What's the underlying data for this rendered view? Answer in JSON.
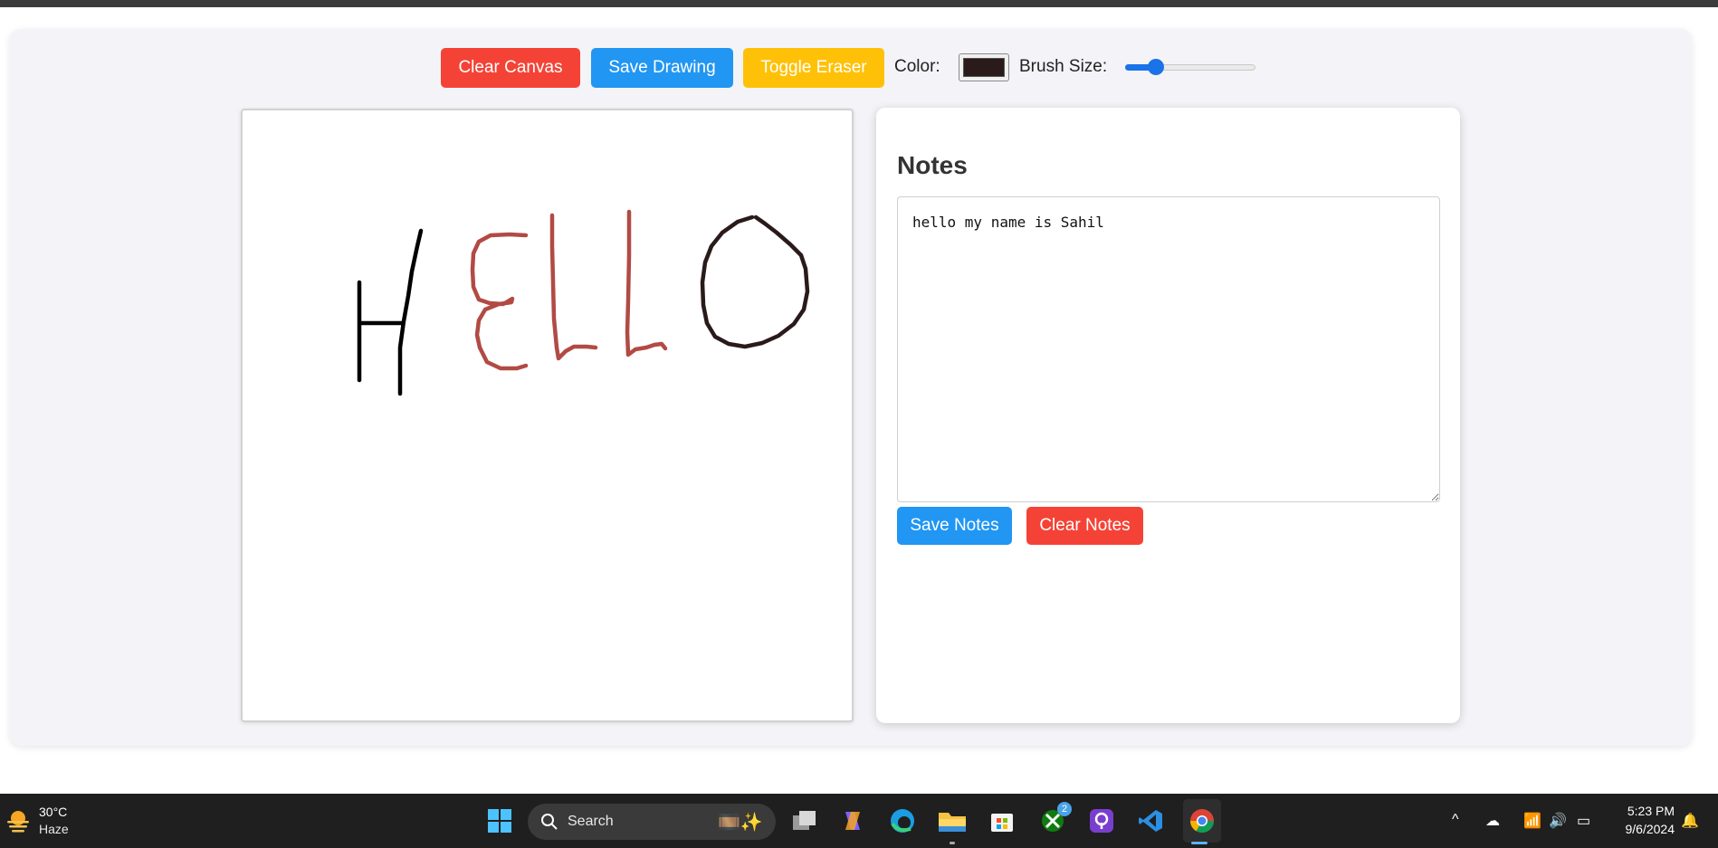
{
  "toolbar": {
    "clear_canvas_label": "Clear Canvas",
    "save_drawing_label": "Save Drawing",
    "toggle_eraser_label": "Toggle Eraser",
    "color_label": "Color:",
    "color_value": "#2a1a1a",
    "brush_size_label": "Brush Size:",
    "brush_size_fraction": 0.2,
    "colors": {
      "clear": "#f44336",
      "save": "#2196f3",
      "eraser": "#ffc107"
    }
  },
  "canvas": {
    "drawn_text": "HELLO",
    "stroke_colors": {
      "H": "#000000",
      "E": "#b24a44",
      "L1": "#b24a44",
      "L2": "#b24a44",
      "O": "#2a1a1a"
    }
  },
  "notes": {
    "title": "Notes",
    "content": "hello my name is Sahil",
    "save_label": "Save Notes",
    "clear_label": "Clear Notes"
  },
  "taskbar": {
    "weather_temp": "30°C",
    "weather_condition": "Haze",
    "search_label": "Search",
    "xbox_badge": "2",
    "time": "5:23 PM",
    "date": "9/6/2024"
  }
}
